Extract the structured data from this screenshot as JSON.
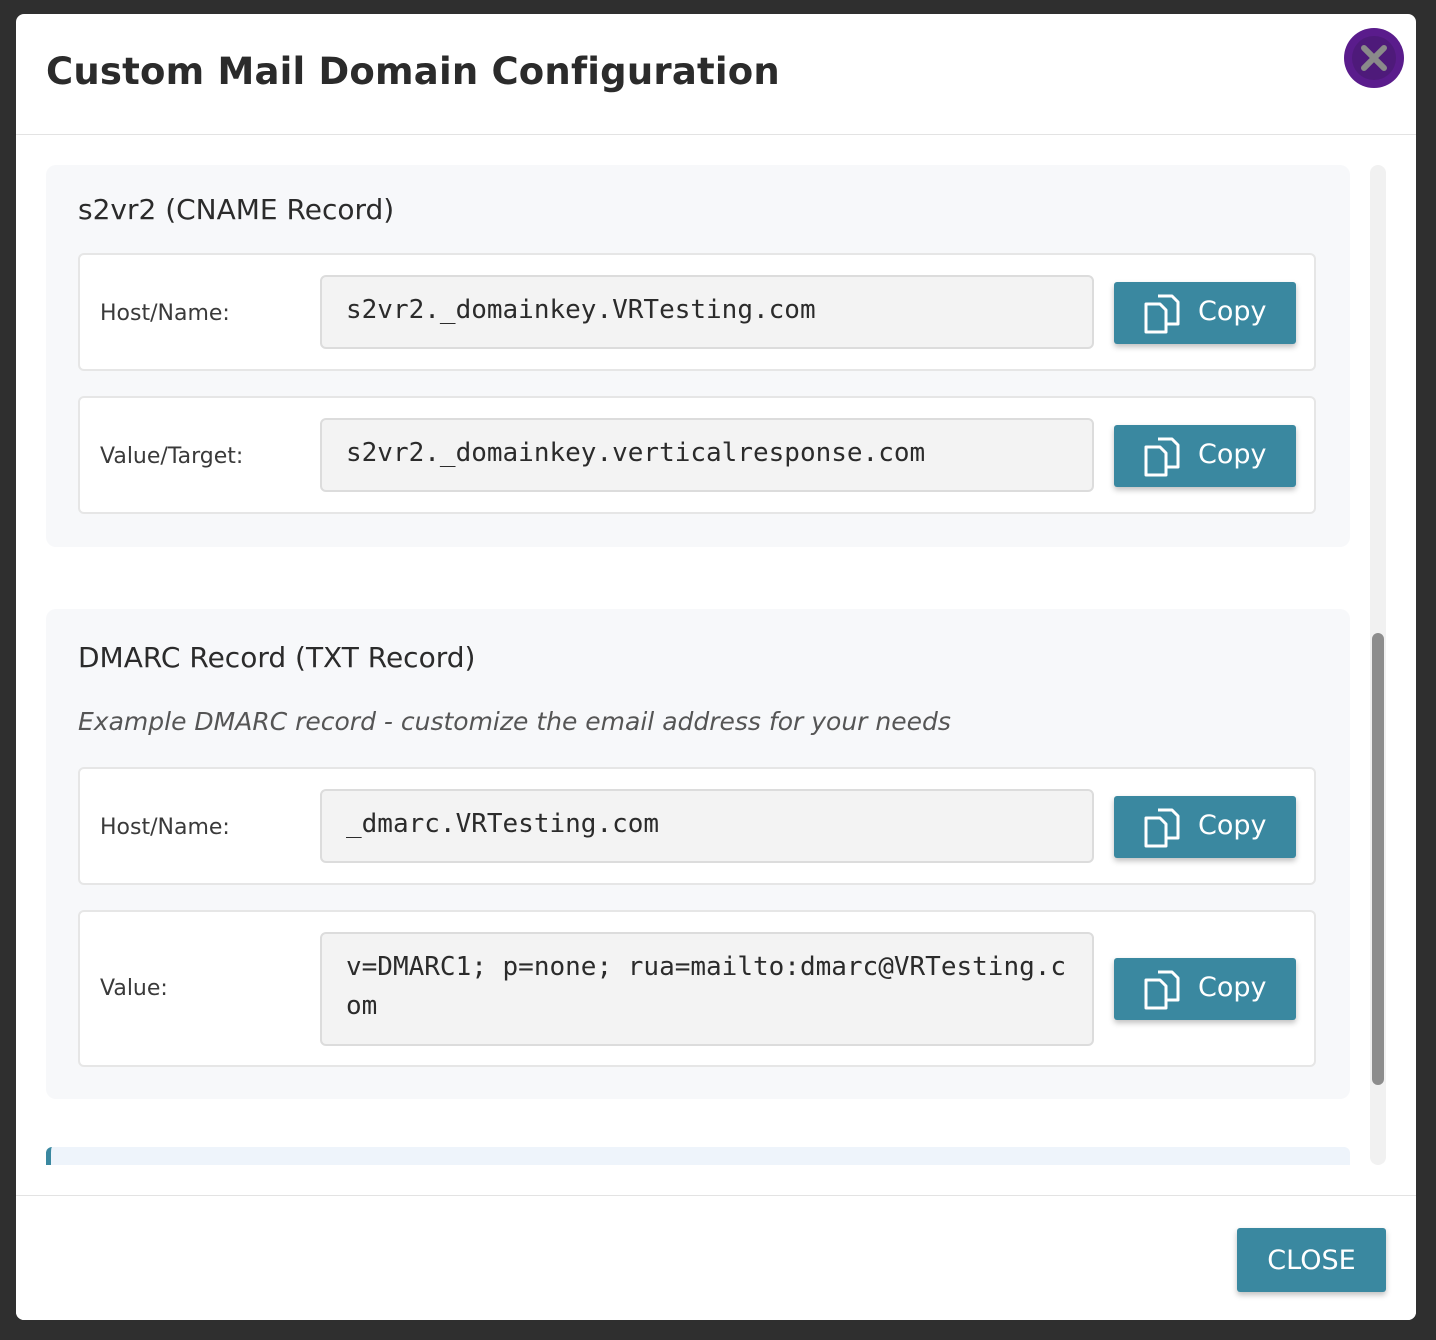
{
  "modal": {
    "title": "Custom Mail Domain Configuration",
    "close_icon": "close-x-icon",
    "close_button_label": "CLOSE",
    "accent_color": "#3a88a0",
    "close_icon_color": "#5a1c8c"
  },
  "cname_section": {
    "title": "s2vr2 (CNAME Record)",
    "rows": [
      {
        "label": "Host/Name:",
        "value": "s2vr2._domainkey.VRTesting.com",
        "copy_label": "Copy",
        "copy_icon": "copy-icon"
      },
      {
        "label": "Value/Target:",
        "value": "s2vr2._domainkey.verticalresponse.com",
        "copy_label": "Copy",
        "copy_icon": "copy-icon"
      }
    ]
  },
  "dmarc_section": {
    "title": "DMARC Record (TXT Record)",
    "note": "Example DMARC record - customize the email address for your needs",
    "rows": [
      {
        "label": "Host/Name:",
        "value": "_dmarc.VRTesting.com",
        "copy_label": "Copy",
        "copy_icon": "copy-icon"
      },
      {
        "label": "Value:",
        "value": "v=DMARC1; p=none; rua=mailto:dmarc@VRTesting.com",
        "copy_label": "Copy",
        "copy_icon": "copy-icon"
      }
    ]
  }
}
